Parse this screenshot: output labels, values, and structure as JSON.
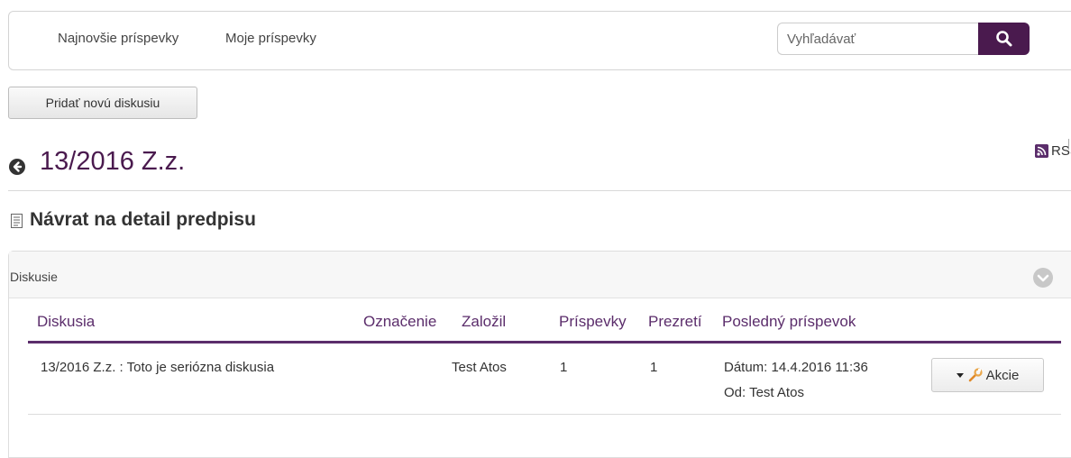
{
  "navbar": {
    "links": [
      "Najnovšie príspevky",
      "Moje príspevky"
    ],
    "search_placeholder": "Vyhľadávať",
    "search_button_icon": "search-icon"
  },
  "actions": {
    "add_discussion": "Pridať novú diskusiu"
  },
  "rss": {
    "label": "RSS",
    "icon": "rss-icon",
    "color": "#5b2d6b"
  },
  "page": {
    "title": "13/2016 Z.z.",
    "back_icon": "arrow-left-circle-icon",
    "return_link": "Návrat na detail predpisu",
    "return_icon": "document-icon"
  },
  "panel": {
    "title": "Diskusie",
    "toggle_icon": "chevron-down-circle-icon",
    "columns": [
      "Diskusia",
      "Označenie",
      "Založil",
      "Príspevky",
      "Prezretí",
      "Posledný príspevok"
    ],
    "rows": [
      {
        "discussion": "13/2016 Z.z. : Toto je seriózna diskusia",
        "label": "",
        "author": "Test Atos",
        "posts": "1",
        "views": "1",
        "last_date": "Dátum: 14.4.2016 11:36",
        "last_by": "Od: Test Atos",
        "action_label": "Akcie"
      }
    ]
  },
  "colors": {
    "accent": "#4a1a4e",
    "heading": "#5b2d6b"
  }
}
